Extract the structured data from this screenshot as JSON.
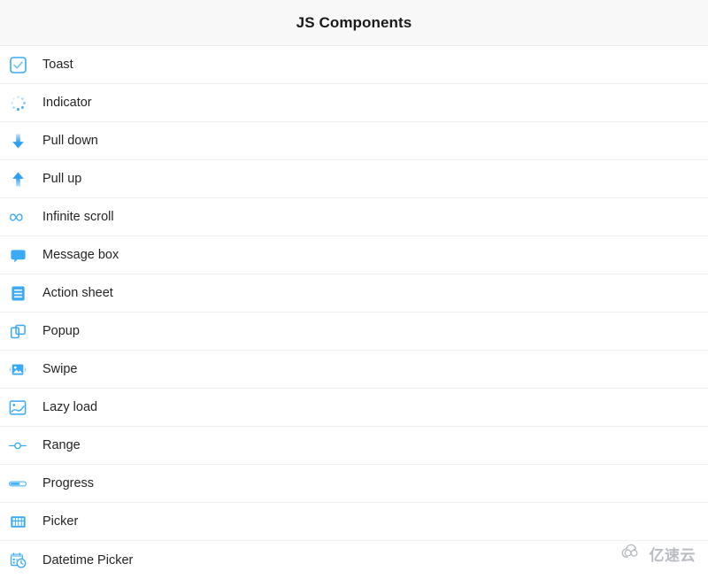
{
  "header": {
    "title": "JS Components"
  },
  "accent_color": "#3aaaf5",
  "list": {
    "items": [
      {
        "label": "Toast",
        "icon": "checkbox-checked-icon"
      },
      {
        "label": "Indicator",
        "icon": "spinner-icon"
      },
      {
        "label": "Pull down",
        "icon": "arrow-down-icon"
      },
      {
        "label": "Pull up",
        "icon": "arrow-up-icon"
      },
      {
        "label": "Infinite scroll",
        "icon": "infinity-icon"
      },
      {
        "label": "Message box",
        "icon": "speech-bubble-icon"
      },
      {
        "label": "Action sheet",
        "icon": "list-lines-icon"
      },
      {
        "label": "Popup",
        "icon": "overlapping-squares-icon"
      },
      {
        "label": "Swipe",
        "icon": "image-swipe-icon"
      },
      {
        "label": "Lazy load",
        "icon": "image-outline-icon"
      },
      {
        "label": "Range",
        "icon": "range-slider-icon"
      },
      {
        "label": "Progress",
        "icon": "progress-bar-icon"
      },
      {
        "label": "Picker",
        "icon": "picker-columns-icon"
      },
      {
        "label": "Datetime Picker",
        "icon": "calendar-clock-icon"
      }
    ]
  },
  "watermark": {
    "text": "亿速云",
    "icon": "cloud-icon"
  }
}
